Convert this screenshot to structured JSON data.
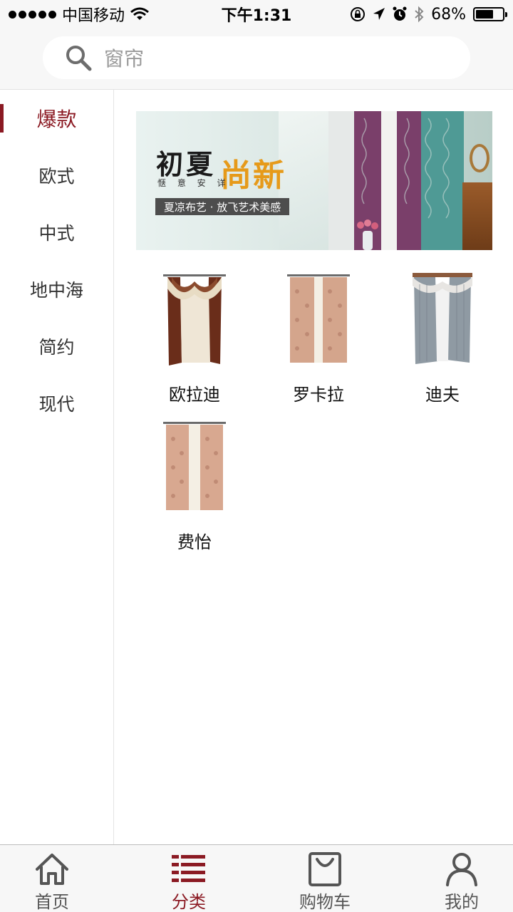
{
  "status_bar": {
    "carrier": "中国移动",
    "time": "下午1:31",
    "battery": "68%",
    "battery_level": 0.68
  },
  "search": {
    "placeholder": "窗帘",
    "icon": "search-icon"
  },
  "sidebar": {
    "items": [
      {
        "label": "爆款",
        "active": true
      },
      {
        "label": "欧式",
        "active": false
      },
      {
        "label": "中式",
        "active": false
      },
      {
        "label": "地中海",
        "active": false
      },
      {
        "label": "简约",
        "active": false
      },
      {
        "label": "现代",
        "active": false
      }
    ]
  },
  "banner": {
    "title_left": "初夏",
    "title_right": "尚新",
    "subtitle": "惬 意 安 详",
    "tag": "夏凉布艺 · 放飞艺术美感"
  },
  "products": [
    {
      "name": "欧拉迪"
    },
    {
      "name": "罗卡拉"
    },
    {
      "name": "迪夫"
    },
    {
      "name": "费怡"
    }
  ],
  "tab_bar": {
    "tabs": [
      {
        "label": "首页",
        "icon": "home-icon",
        "active": false
      },
      {
        "label": "分类",
        "icon": "category-icon",
        "active": true
      },
      {
        "label": "购物车",
        "icon": "cart-icon",
        "active": false
      },
      {
        "label": "我的",
        "icon": "profile-icon",
        "active": false
      }
    ]
  },
  "colors": {
    "accent": "#8b1a23",
    "banner_gold": "#e69a1a"
  }
}
